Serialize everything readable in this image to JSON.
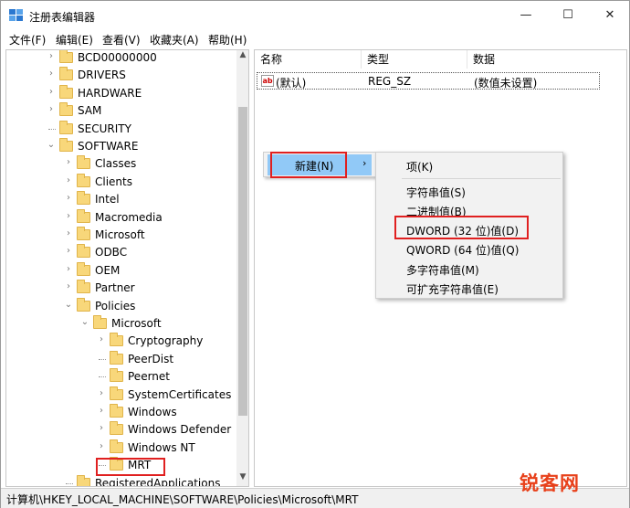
{
  "window": {
    "title": "注册表编辑器",
    "controls": {
      "minimize": "—",
      "maximize": "☐",
      "close": "✕"
    }
  },
  "menubar": [
    "文件(F)",
    "编辑(E)",
    "查看(V)",
    "收藏夹(A)",
    "帮助(H)"
  ],
  "tree": {
    "rows": [
      {
        "label": "BCD00000000",
        "chev": "›"
      },
      {
        "label": "DRIVERS",
        "chev": "›"
      },
      {
        "label": "HARDWARE",
        "chev": "›"
      },
      {
        "label": "SAM",
        "chev": "›"
      },
      {
        "label": "SECURITY",
        "chev": ""
      },
      {
        "label": "SOFTWARE",
        "chev": "⌄"
      },
      {
        "label": "Classes",
        "chev": "›"
      },
      {
        "label": "Clients",
        "chev": "›"
      },
      {
        "label": "Intel",
        "chev": "›"
      },
      {
        "label": "Macromedia",
        "chev": "›"
      },
      {
        "label": "Microsoft",
        "chev": "›"
      },
      {
        "label": "ODBC",
        "chev": "›"
      },
      {
        "label": "OEM",
        "chev": "›"
      },
      {
        "label": "Partner",
        "chev": "›"
      },
      {
        "label": "Policies",
        "chev": "⌄"
      },
      {
        "label": "Microsoft",
        "chev": "⌄"
      },
      {
        "label": "Cryptography",
        "chev": "›"
      },
      {
        "label": "PeerDist",
        "chev": ""
      },
      {
        "label": "Peernet",
        "chev": ""
      },
      {
        "label": "SystemCertificates",
        "chev": "›"
      },
      {
        "label": "Windows",
        "chev": "›"
      },
      {
        "label": "Windows Defender",
        "chev": "›"
      },
      {
        "label": "Windows NT",
        "chev": "›"
      },
      {
        "label": "MRT",
        "chev": ""
      },
      {
        "label": "RegisteredApplications",
        "chev": ""
      }
    ],
    "scroll_up": "▲",
    "scroll_down": "▼"
  },
  "list": {
    "columns": [
      "名称",
      "类型",
      "数据"
    ],
    "rows": [
      {
        "icon": "ab",
        "name": "(默认)",
        "type": "REG_SZ",
        "data": "(数值未设置)"
      }
    ]
  },
  "context_menu": {
    "new_label": "新建(N)",
    "arrow": "›",
    "submenu": [
      "项(K)",
      "字符串值(S)",
      "二进制值(B)",
      "DWORD (32 位)值(D)",
      "QWORD (64 位)值(Q)",
      "多字符串值(M)",
      "可扩充字符串值(E)"
    ]
  },
  "statusbar": {
    "path": "计算机\\HKEY_LOCAL_MACHINE\\SOFTWARE\\Policies\\Microsoft\\MRT"
  },
  "watermark": "锐客网",
  "colors": {
    "highlight": "#91c9f7",
    "annotation": "#e02020",
    "folder": "#f8d77a"
  }
}
